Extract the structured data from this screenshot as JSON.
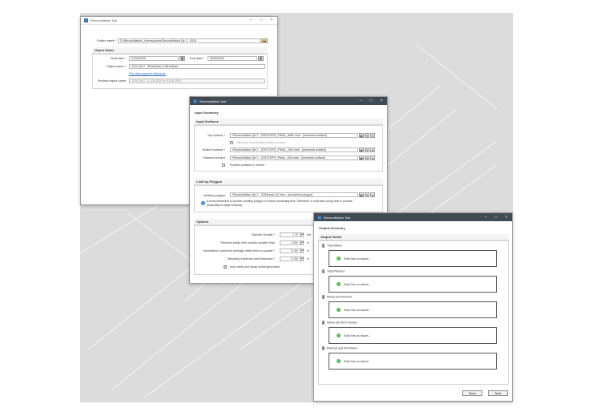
{
  "colors": {
    "titlebar_dark": "#3f4a52",
    "link": "#2266cc",
    "ok": "#52b152",
    "info": "#3e7fc9"
  },
  "window1": {
    "title": "Reconciliation Tool",
    "folder_label": "Folder name *",
    "folder_value": "D:\\Reconciliation\\_Invensources\\Reconciliation Qtr 2 - 2020",
    "object_name_section": "Object Name",
    "start_label": "Start date *",
    "start_value": "01/04/2020",
    "end_label": "End date *",
    "end_value": "30/06/2020",
    "objname_label": "Object name *",
    "objname_value": "2020 Qtr 2 - $StartDate to $EndDate",
    "wildcard_link": "This field supports wildcards.",
    "preview_label": "Preview object name",
    "preview_value": "2020 Qtr 2 - 01-04-2020 to 30-06-2020"
  },
  "window2": {
    "title": "Reconciliation Tool",
    "input_geometry": "Input Geometry",
    "input_surfaces": "Input Surfaces",
    "top_label": "Top surface *",
    "top_value": "\\Reconciliation Qtr 2 - 2020\\TOPO_FINAL_MAR.mrm : [unnamed surface]",
    "use_prior": "Use prior reconciliation bottom surface",
    "bottom_label": "Bottom surface *",
    "bottom_value": "\\Reconciliation Qtr 2 - 2020\\TOPO_FINAL_JUN.mrm : [unnamed surface]",
    "planned_label": "Planned surface",
    "planned_value": "\\Reconciliation Qtr 2 - 2020\\TOPO_Plane_JUN.mrm : [unnamed surface]",
    "preview_surfaces": "Preview surfaces in Viewer",
    "limit_section": "Limit by Polygon",
    "limiting_label": "Limiting polygon",
    "limiting_value": "\\Reconciliation Qtr 2 - 2020\\draw Q2.mrm : [unnamed polygon]",
    "info_text_1": "It is recommended to provide a limiting polygon to reduce processing time. Otherwise, it could take a long time to process",
    "info_text_2": "(especially for large surfaces).",
    "options_section": "Options",
    "sg_label": "Specific Gravity *",
    "sg_value": "2.70",
    "sg_unit": "t/m",
    "remove_label": "Remove solids with volume smaller than",
    "remove_value": "1.000",
    "remove_unit": "m",
    "decim_label": "Decimation maximum average offset from co-planar *",
    "decim_value": "0.100",
    "decim_unit": "m",
    "dimple_label": "Dimpling maximum wall thickness *",
    "dimple_value": "0.100",
    "dimple_unit": "m",
    "autoverify": "Auto-verify and repair solids generated"
  },
  "window3": {
    "title": "Reconciliation Tool",
    "output_geometry": "Output Geometry",
    "output_solids": "Output Solids",
    "solids": [
      {
        "name": "Total Mined",
        "status": "Solid has no issues."
      },
      {
        "name": "Total Planned",
        "status": "Solid has no issues."
      },
      {
        "name": "Mined and Planned",
        "status": "Solid has no issues."
      },
      {
        "name": "Mined and Not Planned",
        "status": "Solid has no issues."
      },
      {
        "name": "Planned and Not Mined",
        "status": "Solid has no issues."
      }
    ],
    "back_label": "Back",
    "next_label": "Next"
  },
  "icons": [
    "app-icon",
    "folder-icon",
    "calendar-icon",
    "pick-icon",
    "info-icon",
    "check-circle-icon",
    "pin-icon"
  ]
}
